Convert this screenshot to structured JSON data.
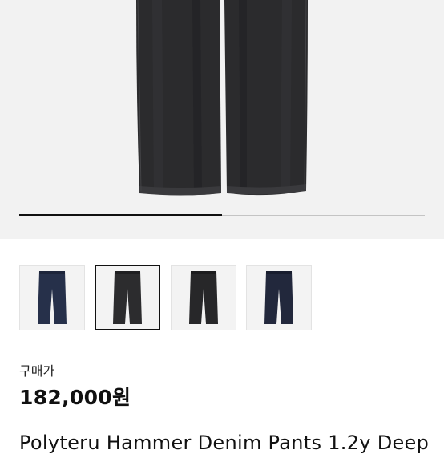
{
  "gallery": {
    "selected_index": 1,
    "image_count": 4,
    "progress_fraction": 0.5,
    "thumbnails": [
      {
        "label": "indigo denim pants",
        "color": "#26304a"
      },
      {
        "label": "black denim pants",
        "color": "#2c2c2e"
      },
      {
        "label": "black denim pants alternate",
        "color": "#272729"
      },
      {
        "label": "navy denim pants",
        "color": "#22283c"
      }
    ]
  },
  "product": {
    "price_label": "구매가",
    "price": "182,000원",
    "title": "Polyteru Hammer Denim Pants 1.2y Deep"
  },
  "colors": {
    "hero_background": "#f2f2f2",
    "main_pants": "#2b2b2d",
    "selected_border": "#111111"
  }
}
